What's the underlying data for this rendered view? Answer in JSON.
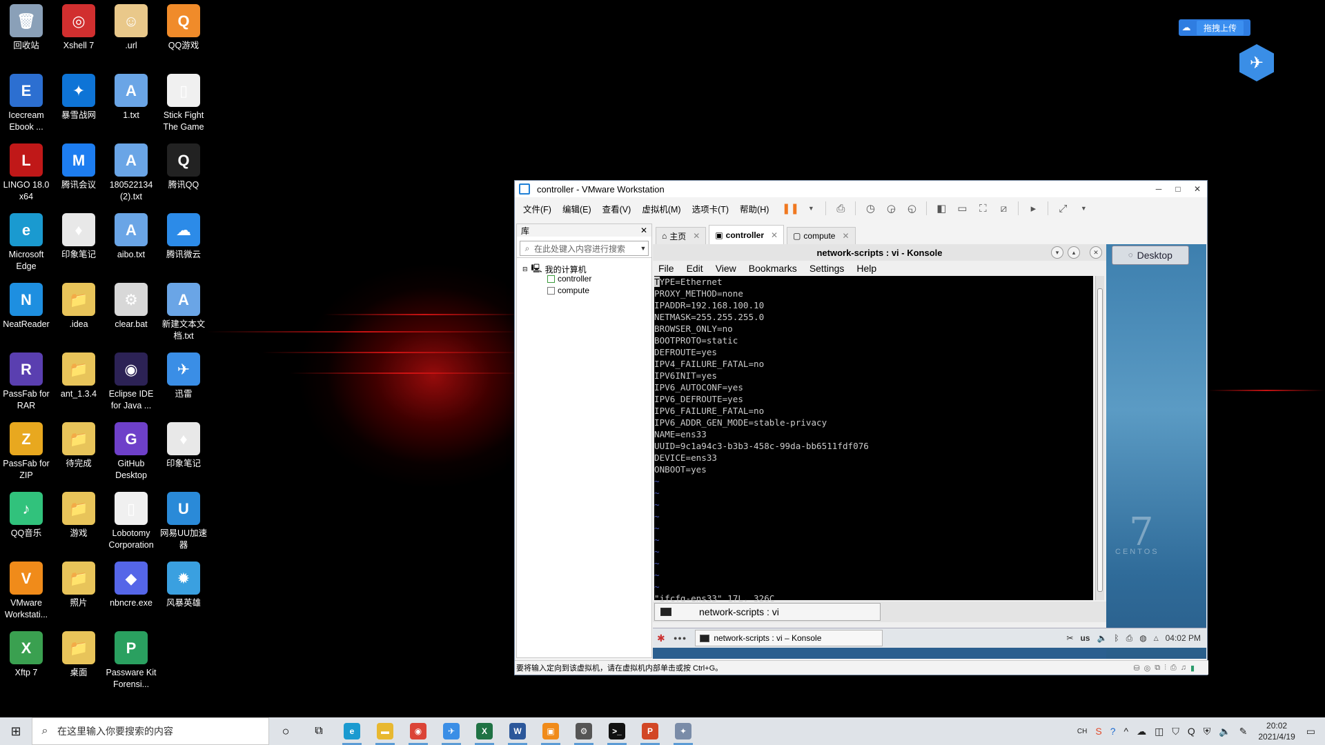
{
  "desktop_icons": [
    {
      "label": "回收站",
      "glyph": "🗑",
      "color": "#8aa0b8"
    },
    {
      "label": "Xshell 7",
      "glyph": "◎",
      "color": "#d12f2f"
    },
    {
      "label": ".url",
      "glyph": "☺",
      "color": "#e9c88a"
    },
    {
      "label": "QQ游戏",
      "glyph": "Q",
      "color": "#f08b2a"
    },
    {
      "label": "Icecream Ebook ...",
      "glyph": "E",
      "color": "#2c6fd1"
    },
    {
      "label": "暴雪战网",
      "glyph": "✦",
      "color": "#0e74d6"
    },
    {
      "label": "1.txt",
      "glyph": "A",
      "color": "#6aa5e6"
    },
    {
      "label": "Stick Fight The Game",
      "glyph": "▯",
      "color": "#f0f0f0"
    },
    {
      "label": "LINGO 18.0 x64",
      "glyph": "L",
      "color": "#c01818"
    },
    {
      "label": "腾讯会议",
      "glyph": "M",
      "color": "#1d7df0"
    },
    {
      "label": "180522134 (2).txt",
      "glyph": "A",
      "color": "#6aa5e6"
    },
    {
      "label": "腾讯QQ",
      "glyph": "Q",
      "color": "#222"
    },
    {
      "label": "Microsoft Edge",
      "glyph": "e",
      "color": "#1a9ad0"
    },
    {
      "label": "印象笔记",
      "glyph": "♦",
      "color": "#e8e8e8"
    },
    {
      "label": "aibo.txt",
      "glyph": "A",
      "color": "#6aa5e6"
    },
    {
      "label": "腾讯微云",
      "glyph": "☁",
      "color": "#2c8be8"
    },
    {
      "label": "NeatReader",
      "glyph": "N",
      "color": "#1e8fe0"
    },
    {
      "label": ".idea",
      "glyph": "📁",
      "color": "#e8c45a"
    },
    {
      "label": "clear.bat",
      "glyph": "⚙",
      "color": "#d8d8d8"
    },
    {
      "label": "新建文本文 档.txt",
      "glyph": "A",
      "color": "#6aa5e6"
    },
    {
      "label": "PassFab for RAR",
      "glyph": "R",
      "color": "#5a3fb0"
    },
    {
      "label": "ant_1.3.4",
      "glyph": "📁",
      "color": "#e8c45a"
    },
    {
      "label": "Eclipse IDE for Java ...",
      "glyph": "◉",
      "color": "#2c2255"
    },
    {
      "label": "迅雷",
      "glyph": "✈",
      "color": "#3a8ee6"
    },
    {
      "label": "PassFab for ZIP",
      "glyph": "Z",
      "color": "#e8a81f"
    },
    {
      "label": "待完成",
      "glyph": "📁",
      "color": "#e8c45a"
    },
    {
      "label": "GitHub Desktop",
      "glyph": "G",
      "color": "#6e40c9"
    },
    {
      "label": "印象笔记",
      "glyph": "♦",
      "color": "#e8e8e8"
    },
    {
      "label": "QQ音乐",
      "glyph": "♪",
      "color": "#31c27c"
    },
    {
      "label": "游戏",
      "glyph": "📁",
      "color": "#e8c45a"
    },
    {
      "label": "Lobotomy Corporation",
      "glyph": "▯",
      "color": "#f0f0f0"
    },
    {
      "label": "网易UU加速 器",
      "glyph": "U",
      "color": "#2a8ad8"
    },
    {
      "label": "VMware Workstati...",
      "glyph": "V",
      "color": "#f08b1a"
    },
    {
      "label": "照片",
      "glyph": "📁",
      "color": "#e8c45a"
    },
    {
      "label": "nbncre.exe",
      "glyph": "◆",
      "color": "#5566e8"
    },
    {
      "label": "风暴英雄",
      "glyph": "✹",
      "color": "#3aa0e0"
    },
    {
      "label": "Xftp 7",
      "glyph": "X",
      "color": "#3aa050"
    },
    {
      "label": "桌面",
      "glyph": "📁",
      "color": "#e8c45a"
    },
    {
      "label": "Passware Kit Forensi...",
      "glyph": "P",
      "color": "#2aa060"
    }
  ],
  "baidu": {
    "button": "拖拽上传"
  },
  "vmware": {
    "title": "controller - VMware Workstation",
    "menus": [
      "文件(F)",
      "编辑(E)",
      "查看(V)",
      "虚拟机(M)",
      "选项卡(T)",
      "帮助(H)"
    ],
    "library": {
      "header": "库",
      "search_placeholder": "在此处键入内容进行搜索",
      "root": "我的计算机",
      "vms": [
        "controller",
        "compute"
      ]
    },
    "tabs": [
      {
        "label": "主页",
        "icon": "home-icon"
      },
      {
        "label": "controller",
        "icon": "vm-icon"
      },
      {
        "label": "compute",
        "icon": "vm-icon"
      }
    ],
    "status_text": "要将输入定向到该虚拟机，请在虚拟机内部单击或按 Ctrl+G。"
  },
  "guest": {
    "desktop_button": "Desktop",
    "centos_mark": "CENTOS",
    "centos_version": "7",
    "konsole": {
      "title": "network-scripts : vi - Konsole",
      "menus": [
        "File",
        "Edit",
        "View",
        "Bookmarks",
        "Settings",
        "Help"
      ],
      "lines": [
        "TYPE=Ethernet",
        "PROXY_METHOD=none",
        "IPADDR=192.168.100.10",
        "NETMASK=255.255.255.0",
        "BROWSER_ONLY=no",
        "BOOTPROTO=static",
        "DEFROUTE=yes",
        "IPV4_FAILURE_FATAL=no",
        "IPV6INIT=yes",
        "IPV6_AUTOCONF=yes",
        "IPV6_DEFROUTE=yes",
        "IPV6_FAILURE_FATAL=no",
        "IPV6_ADDR_GEN_MODE=stable-privacy",
        "NAME=ens33",
        "UUID=9c1a94c3-b3b3-458c-99da-bb6511fdf076",
        "DEVICE=ens33",
        "ONBOOT=yes"
      ],
      "tilde_count": 10,
      "status_line": "\"ifcfg-ens33\" 17L, 326C",
      "tab_label": "network-scripts : vi"
    },
    "taskbar": {
      "task": "network-scripts : vi – Konsole",
      "keyboard": "us",
      "time": "04:02 PM"
    }
  },
  "host_taskbar": {
    "search_placeholder": "在这里输入你要搜索的内容",
    "apps": [
      {
        "name": "edge",
        "glyph": "e",
        "color": "#1a9ad0"
      },
      {
        "name": "explorer",
        "glyph": "▬",
        "color": "#e8b830"
      },
      {
        "name": "chrome",
        "glyph": "◉",
        "color": "#db4437"
      },
      {
        "name": "thunder",
        "glyph": "✈",
        "color": "#3a8ee6"
      },
      {
        "name": "excel",
        "glyph": "X",
        "color": "#1f7244"
      },
      {
        "name": "word",
        "glyph": "W",
        "color": "#2b579a"
      },
      {
        "name": "vmware",
        "glyph": "▣",
        "color": "#f08b1a"
      },
      {
        "name": "settings",
        "glyph": "⚙",
        "color": "#555"
      },
      {
        "name": "terminal",
        "glyph": ">_",
        "color": "#111"
      },
      {
        "name": "powerpoint",
        "glyph": "P",
        "color": "#d24726"
      },
      {
        "name": "app-extra",
        "glyph": "✦",
        "color": "#7a8ca8"
      }
    ],
    "ime": "CH",
    "time": "20:02",
    "date": "2021/4/19"
  }
}
